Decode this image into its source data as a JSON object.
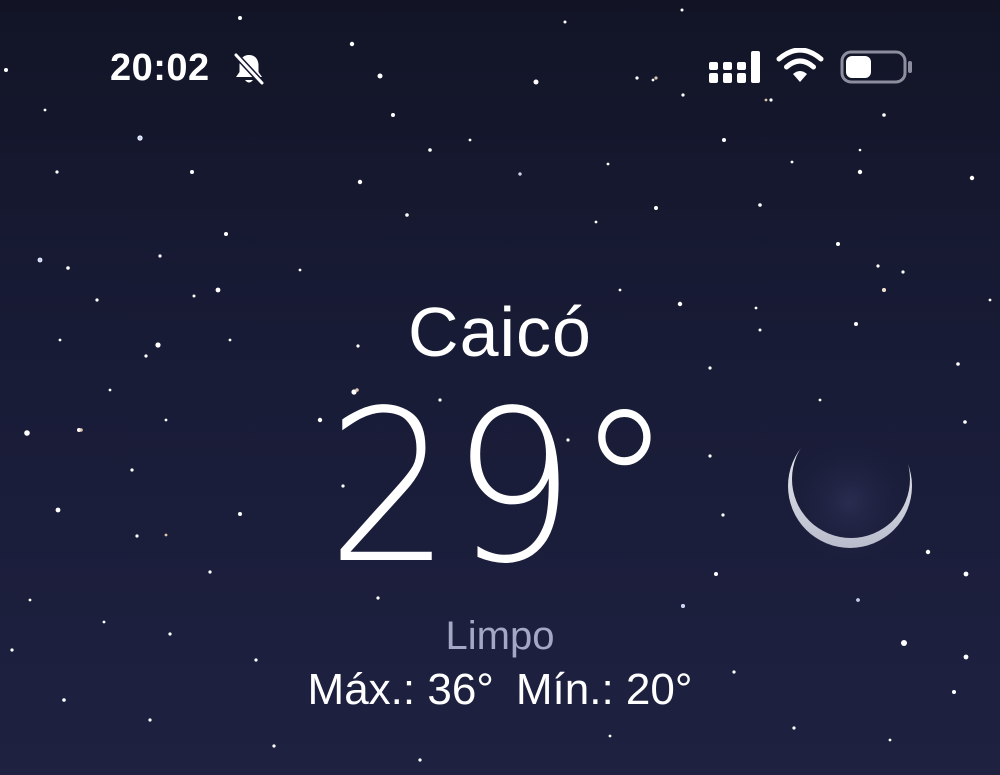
{
  "status_bar": {
    "time": "20:02",
    "icons": [
      "bell-slash-icon",
      "cellular-signal-icon",
      "wifi-icon",
      "battery-icon"
    ]
  },
  "weather": {
    "city": "Caicó",
    "temperature": "29°",
    "condition": "Limpo",
    "high_label": "Máx.: 36°",
    "low_label": "Mín.: 20°"
  },
  "colors": {
    "sky_top": "#121426",
    "sky_bottom": "#1e2140",
    "text_primary": "#ffffff",
    "text_secondary": "#a5a8c5"
  },
  "background": {
    "theme": "night-clear-sky",
    "icons": [
      "star-icon",
      "moon-icon"
    ]
  }
}
